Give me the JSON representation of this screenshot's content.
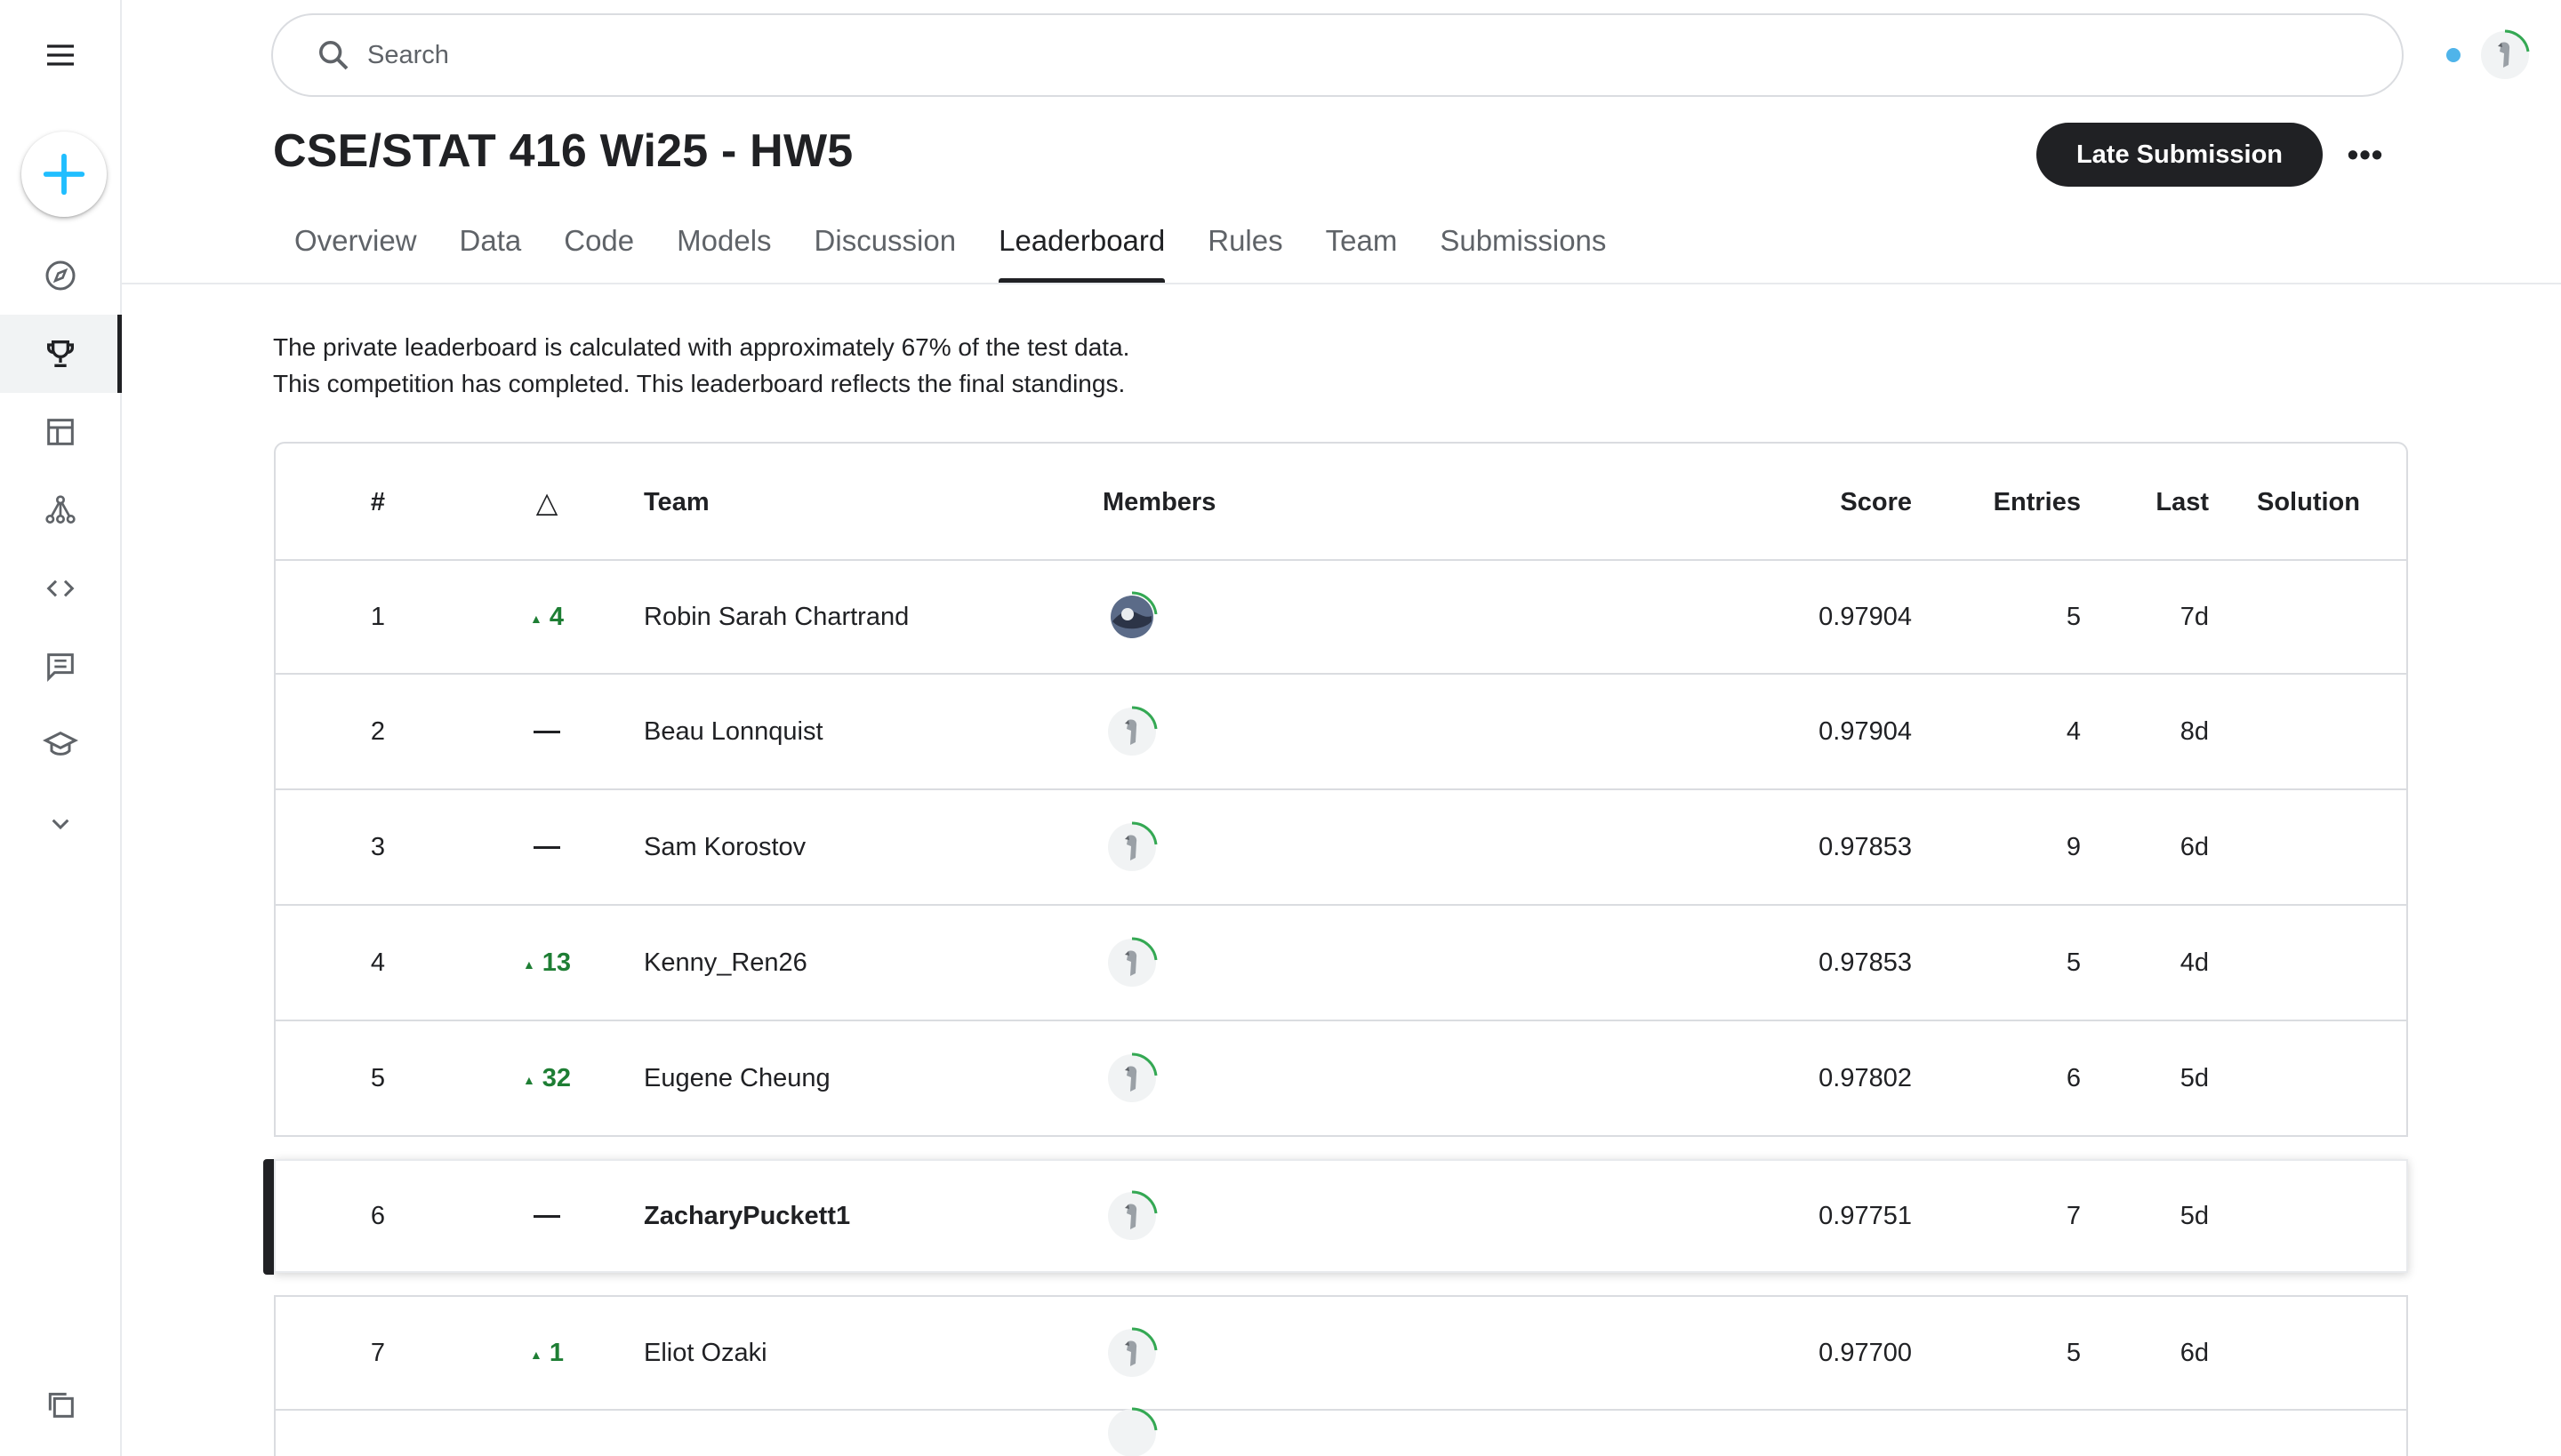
{
  "search": {
    "placeholder": "Search"
  },
  "header": {
    "title": "CSE/STAT 416 Wi25 - HW5",
    "late_submission": "Late Submission",
    "more": "•••"
  },
  "tabs": [
    {
      "label": "Overview"
    },
    {
      "label": "Data"
    },
    {
      "label": "Code"
    },
    {
      "label": "Models"
    },
    {
      "label": "Discussion"
    },
    {
      "label": "Leaderboard",
      "active": true
    },
    {
      "label": "Rules"
    },
    {
      "label": "Team"
    },
    {
      "label": "Submissions"
    }
  ],
  "info": {
    "line1": "The private leaderboard is calculated with approximately 67% of the test data.",
    "line2": "This competition has completed. This leaderboard reflects the final standings."
  },
  "table": {
    "headers": {
      "rank": "#",
      "delta": "△",
      "team": "Team",
      "members": "Members",
      "score": "Score",
      "entries": "Entries",
      "last": "Last",
      "solution": "Solution"
    },
    "rows": [
      {
        "rank": "1",
        "delta": "4",
        "delta_dir": "up",
        "team": "Robin Sarah Chartrand",
        "score": "0.97904",
        "entries": "5",
        "last": "7d",
        "avatar": "photo-avatar"
      },
      {
        "rank": "2",
        "delta": "",
        "delta_dir": "none",
        "team": "Beau Lonnquist",
        "score": "0.97904",
        "entries": "4",
        "last": "8d",
        "avatar": "default-avatar"
      },
      {
        "rank": "3",
        "delta": "",
        "delta_dir": "none",
        "team": "Sam Korostov",
        "score": "0.97853",
        "entries": "9",
        "last": "6d",
        "avatar": "default-avatar"
      },
      {
        "rank": "4",
        "delta": "13",
        "delta_dir": "up",
        "team": "Kenny_Ren26",
        "score": "0.97853",
        "entries": "5",
        "last": "4d",
        "avatar": "default-avatar"
      },
      {
        "rank": "5",
        "delta": "32",
        "delta_dir": "up",
        "team": "Eugene Cheung",
        "score": "0.97802",
        "entries": "6",
        "last": "5d",
        "avatar": "default-avatar"
      },
      {
        "rank": "6",
        "delta": "",
        "delta_dir": "none",
        "team": "ZacharyPuckett1",
        "score": "0.97751",
        "entries": "7",
        "last": "5d",
        "avatar": "default-avatar",
        "is_me": true
      },
      {
        "rank": "7",
        "delta": "1",
        "delta_dir": "up",
        "team": "Eliot Ozaki",
        "score": "0.97700",
        "entries": "5",
        "last": "6d",
        "avatar": "default-avatar"
      }
    ]
  },
  "colors": {
    "accent_blue": "#20beff",
    "positive_green": "#1e7e34",
    "dark": "#202124",
    "avatar_ring": "#34a853"
  },
  "sidebar_icons": [
    "menu-icon",
    "create-icon",
    "explore-icon",
    "competitions-icon",
    "datasets-icon",
    "models-icon",
    "code-icon",
    "discussions-icon",
    "learn-icon",
    "more-icon",
    "your-work-icon"
  ]
}
